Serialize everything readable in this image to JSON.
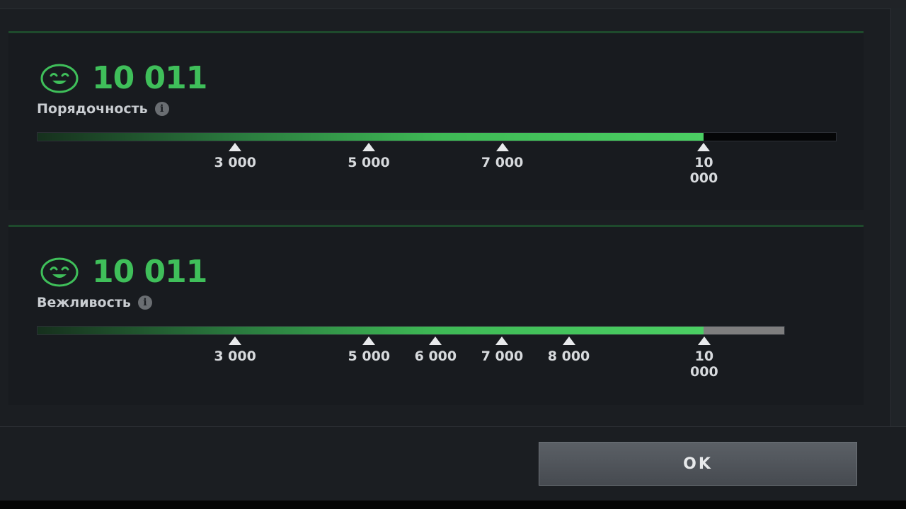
{
  "panels": [
    {
      "score": "10 011",
      "label": "Порядочность",
      "progress": 0.834,
      "track_color": "#050607",
      "markers": [
        {
          "label": "3 000",
          "fraction": 0.248
        },
        {
          "label": "5 000",
          "fraction": 0.415
        },
        {
          "label": "7 000",
          "fraction": 0.582
        },
        {
          "label": "10 000",
          "fraction": 0.834
        }
      ]
    },
    {
      "score": "10 011",
      "label": "Вежливость",
      "progress": 0.892,
      "track_color": "#7e7e7e",
      "markers": [
        {
          "label": "3 000",
          "fraction": 0.265
        },
        {
          "label": "5 000",
          "fraction": 0.444
        },
        {
          "label": "6 000",
          "fraction": 0.533
        },
        {
          "label": "7 000",
          "fraction": 0.622
        },
        {
          "label": "8 000",
          "fraction": 0.711
        },
        {
          "label": "10 000",
          "fraction": 0.892
        }
      ]
    }
  ],
  "ok_label": "OK",
  "colors": {
    "accent_green": "#3fbf5a",
    "background": "#1b1e22",
    "panel": "#181b1f"
  },
  "icons": {
    "face": "smiling-face-icon",
    "info": "info-icon"
  }
}
